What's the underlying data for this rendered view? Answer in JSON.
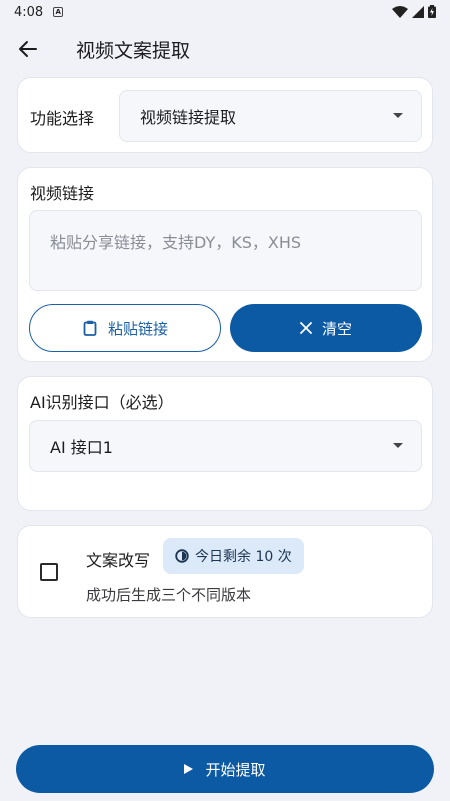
{
  "status_bar": {
    "time": "4:08",
    "badge": "A"
  },
  "app_bar": {
    "title": "视频文案提取"
  },
  "function_card": {
    "label": "功能选择",
    "selected": "视频链接提取"
  },
  "link_card": {
    "label": "视频链接",
    "input_placeholder": "粘贴分享链接，支持DY，KS，XHS",
    "paste_button": "粘贴链接",
    "clear_button": "清空"
  },
  "ai_card": {
    "label": "AI识别接口（必选）",
    "selected": "AI 接口1"
  },
  "rewrite_card": {
    "title": "文案改写",
    "quota": "今日剩余 10 次",
    "subtitle": "成功后生成三个不同版本",
    "checked": false
  },
  "start_button": {
    "label": "开始提取"
  },
  "colors": {
    "primary": "#0d5aa4",
    "background": "#f1f2f7",
    "chip": "#dbe9f8"
  }
}
